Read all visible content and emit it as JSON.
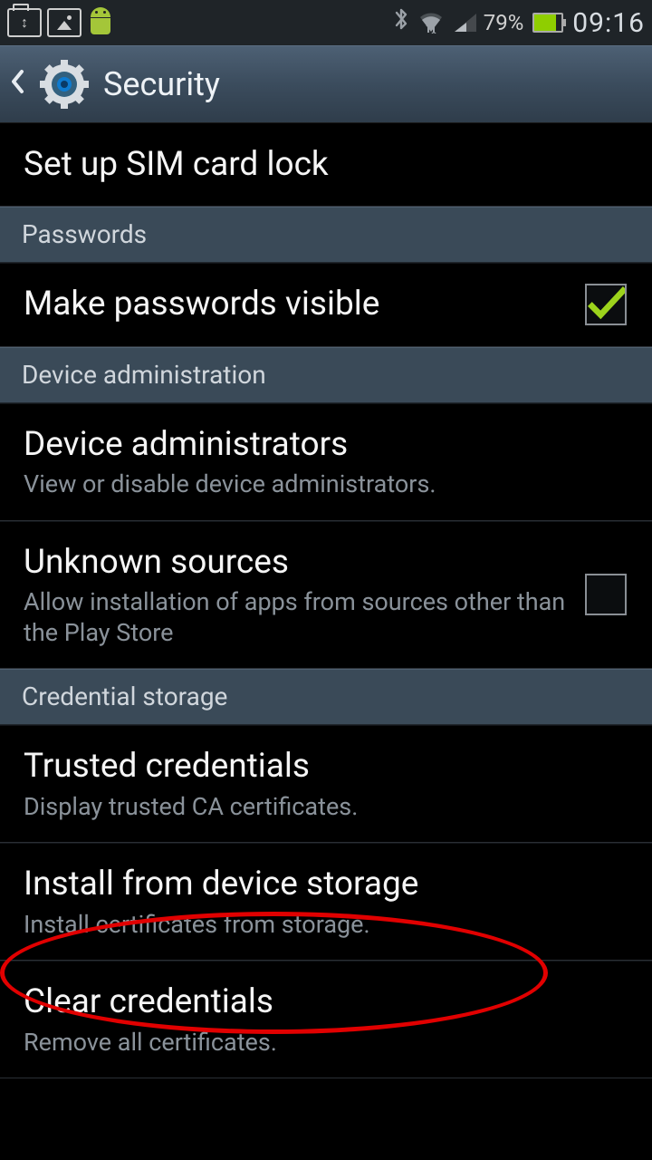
{
  "status_bar": {
    "battery_pct": "79%",
    "clock": "09:16"
  },
  "action_bar": {
    "title": "Security"
  },
  "items": {
    "sim_lock": {
      "title": "Set up SIM card lock"
    },
    "passwords_header": "Passwords",
    "make_pw_visible": {
      "title": "Make passwords visible",
      "checked": true
    },
    "device_admin_header": "Device administration",
    "device_admins": {
      "title": "Device administrators",
      "sub": "View or disable device administrators."
    },
    "unknown_sources": {
      "title": "Unknown sources",
      "sub": "Allow installation of apps from sources other than the Play Store",
      "checked": false
    },
    "cred_storage_header": "Credential storage",
    "trusted_creds": {
      "title": "Trusted credentials",
      "sub": "Display trusted CA certificates."
    },
    "install_from_storage": {
      "title": "Install from device storage",
      "sub": "Install certificates from storage."
    },
    "clear_creds": {
      "title": "Clear credentials",
      "sub": "Remove all certificates."
    }
  }
}
